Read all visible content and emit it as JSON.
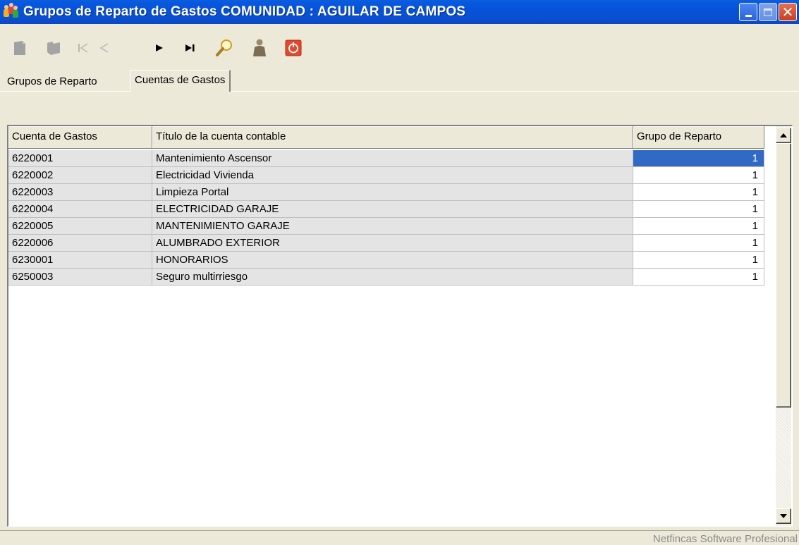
{
  "window": {
    "title": "Grupos de Reparto de Gastos COMUNIDAD : AGUILAR DE CAMPOS",
    "icon": "people-group-icon"
  },
  "toolbar": {
    "buttons": [
      {
        "name": "new-record",
        "icon": "document-icon",
        "enabled": false
      },
      {
        "name": "edit-record",
        "icon": "folder-icon",
        "enabled": false
      },
      {
        "name": "first-record",
        "icon": "first-icon",
        "enabled": false
      },
      {
        "name": "previous-record",
        "icon": "previous-icon",
        "enabled": false
      },
      {
        "name": "next-record",
        "icon": "next-icon",
        "enabled": true
      },
      {
        "name": "last-record",
        "icon": "last-icon",
        "enabled": true
      },
      {
        "name": "search",
        "icon": "magnifier-icon",
        "enabled": true
      },
      {
        "name": "user",
        "icon": "person-icon",
        "enabled": true
      },
      {
        "name": "exit",
        "icon": "power-icon",
        "enabled": true
      }
    ]
  },
  "tabs": [
    {
      "label": "Grupos de Reparto",
      "active": false
    },
    {
      "label": "Cuentas de Gastos",
      "active": true
    }
  ],
  "grid": {
    "columns": [
      "Cuenta de Gastos",
      "Título de la cuenta contable",
      "Grupo de Reparto"
    ],
    "rows": [
      {
        "cuenta": "6220001",
        "titulo": "Mantenimiento Ascensor",
        "grupo": "1"
      },
      {
        "cuenta": "6220002",
        "titulo": "Electricidad Vivienda",
        "grupo": "1"
      },
      {
        "cuenta": "6220003",
        "titulo": "Limpieza Portal",
        "grupo": "1"
      },
      {
        "cuenta": "6220004",
        "titulo": "ELECTRICIDAD GARAJE",
        "grupo": "1"
      },
      {
        "cuenta": "6220005",
        "titulo": "MANTENIMIENTO GARAJE",
        "grupo": "1"
      },
      {
        "cuenta": "6220006",
        "titulo": "ALUMBRADO EXTERIOR",
        "grupo": "1"
      },
      {
        "cuenta": "6230001",
        "titulo": "HONORARIOS",
        "grupo": "1"
      },
      {
        "cuenta": "6250003",
        "titulo": "Seguro multirriesgo",
        "grupo": "1"
      }
    ],
    "selected_row": 0
  },
  "status": {
    "text": "Netfincas Software Profesional"
  },
  "colors": {
    "titlebar": "#0553d8",
    "selection": "#316ac5",
    "readonly_cell": "#e4e4e4",
    "face": "#ece9d8"
  }
}
